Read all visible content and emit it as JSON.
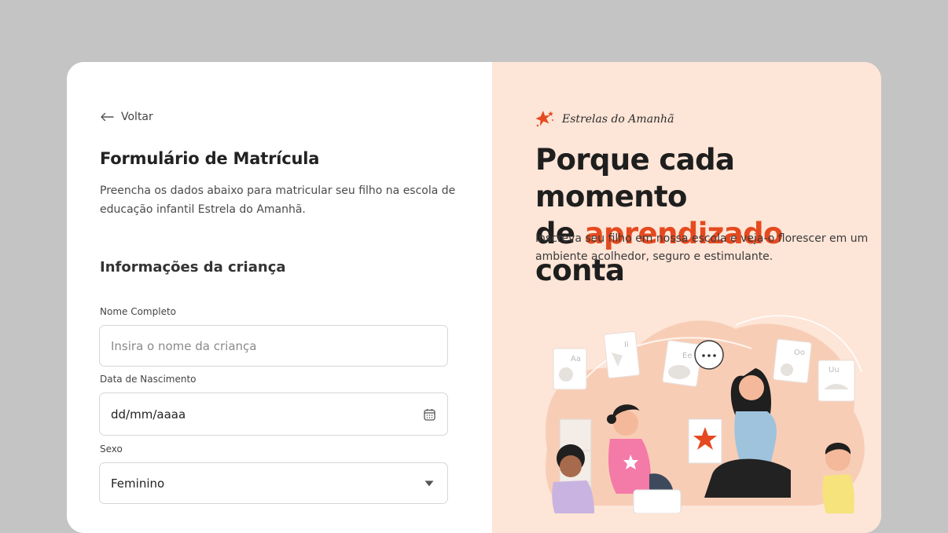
{
  "left": {
    "back_label": "Voltar",
    "form_title": "Formulário de Matrícula",
    "form_description": "Preencha os dados abaixo para matricular seu filho na escola de educação infantil Estrela do Amanhã.",
    "section_title": "Informações da criança",
    "fields": {
      "name": {
        "label": "Nome Completo",
        "placeholder": "Insira o nome da criança",
        "value": ""
      },
      "birthdate": {
        "label": "Data de Nascimento",
        "value": "dd/mm/aaaa",
        "icon": "calendar-icon"
      },
      "sex": {
        "label": "Sexo",
        "value": "Feminino",
        "icon": "caret-down-icon"
      }
    }
  },
  "right": {
    "brand_name": "Estrelas do Amanhã",
    "brand_icon": "star-burst-icon",
    "hero_title_part1": "Porque cada momento",
    "hero_title_part2": "de ",
    "hero_title_accent": "aprendizado",
    "hero_title_part3": " conta",
    "hero_subtitle": "Inscreva seu filho em nossa escola e veja-o florescer em um ambiente acolhedor, seguro e estimulante.",
    "cards": {
      "card1": "Aa",
      "card2": "Ii",
      "card3": "Ee",
      "card4": "Oo",
      "card5": "Uu",
      "speech": "..."
    }
  },
  "colors": {
    "accent": "#e6491f",
    "panel": "#fde5d7",
    "backdrop": "#c4c4c4"
  }
}
